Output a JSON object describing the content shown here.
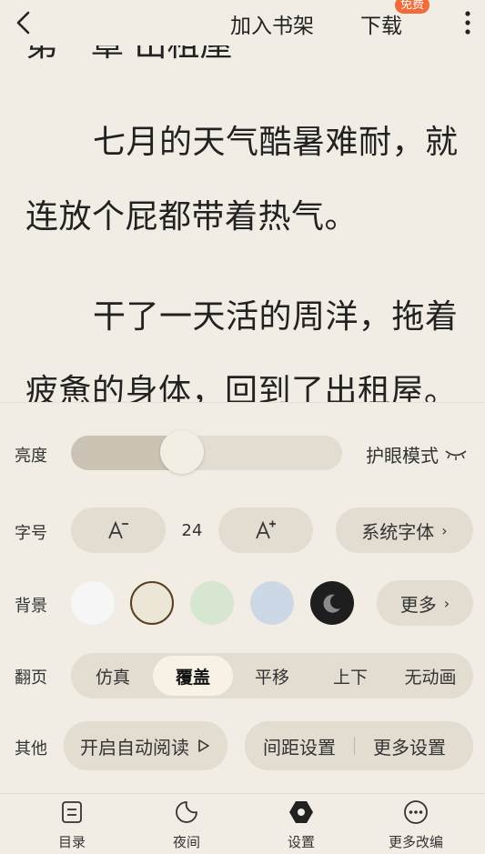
{
  "topbar": {
    "add_shelf": "加入书架",
    "download": "下载",
    "free_badge": "免费"
  },
  "reading": {
    "cut_line": "第一章 出租屋",
    "paragraphs": [
      "七月的天气酷暑难耐，就连放个屁都带着热气。",
      "干了一天活的周洋，拖着疲惫的身体，回到了出租屋。"
    ]
  },
  "settings": {
    "brightness": {
      "label": "亮度",
      "value_fraction": 0.41,
      "eye_mode": "护眼模式"
    },
    "font": {
      "label": "字号",
      "size": "24",
      "family": "系统字体"
    },
    "background": {
      "label": "背景",
      "more": "更多",
      "selected_index": 1,
      "colors": [
        "#f6f6f6",
        "#ece6d6",
        "#d7e6d0",
        "#cdd8e6",
        "#1e1e1e"
      ]
    },
    "page_turn": {
      "label": "翻页",
      "options": [
        "仿真",
        "覆盖",
        "平移",
        "上下",
        "无动画"
      ],
      "selected_index": 1
    },
    "other": {
      "label": "其他",
      "auto_read": "开启自动阅读",
      "spacing": "间距设置",
      "more_settings": "更多设置"
    }
  },
  "bottom_nav": {
    "items": [
      "目录",
      "夜间",
      "设置",
      "更多改编"
    ]
  },
  "colors": {
    "bg": "#f1ede4",
    "pill": "#e2ddd0",
    "badge": "#f26b3a",
    "swatch_border": "#5a3f1f"
  }
}
